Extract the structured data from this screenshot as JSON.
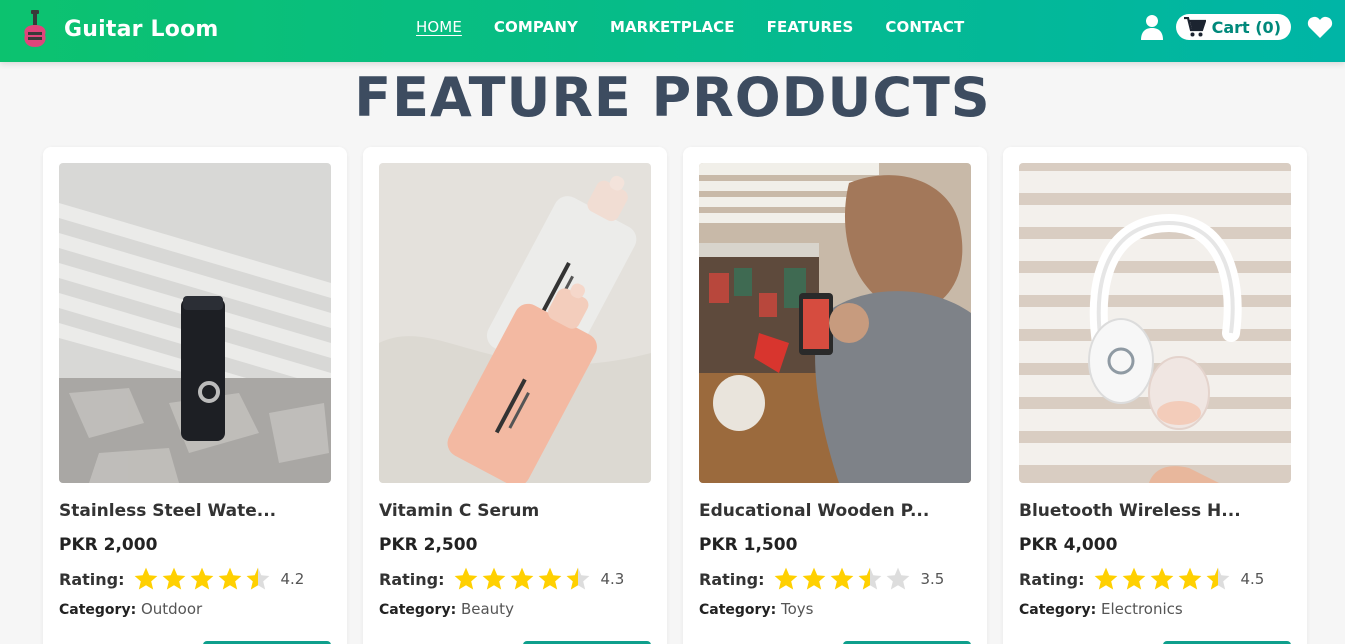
{
  "header": {
    "brand": "Guitar Loom",
    "nav": [
      "HOME",
      "COMPANY",
      "MARKETPLACE",
      "FEATURES",
      "CONTACT"
    ],
    "active_nav": "HOME",
    "cart_label": "Cart (0)"
  },
  "section": {
    "title": "FEATURE PRODUCTS"
  },
  "products": [
    {
      "name": "Stainless Steel Wate...",
      "price": "PKR 2,000",
      "rating_label": "Rating:",
      "rating": "4.2",
      "category_label": "Category:",
      "category": "Outdoor"
    },
    {
      "name": "Vitamin C Serum",
      "price": "PKR 2,500",
      "rating_label": "Rating:",
      "rating": "4.3",
      "category_label": "Category:",
      "category": "Beauty"
    },
    {
      "name": "Educational Wooden P...",
      "price": "PKR 1,500",
      "rating_label": "Rating:",
      "rating": "3.5",
      "category_label": "Category:",
      "category": "Toys"
    },
    {
      "name": "Bluetooth Wireless H...",
      "price": "PKR 4,000",
      "rating_label": "Rating:",
      "rating": "4.5",
      "category_label": "Category:",
      "category": "Electronics"
    }
  ],
  "colors": {
    "header_start": "#0cc26f",
    "header_end": "#00b5a6",
    "title": "#3d4c60",
    "star": "#ffd000",
    "star_empty": "#dddddd",
    "button": "#0e9f8c"
  },
  "icons": [
    "guitar-logo-icon",
    "user-icon",
    "cart-icon",
    "heart-icon",
    "star-icon"
  ]
}
